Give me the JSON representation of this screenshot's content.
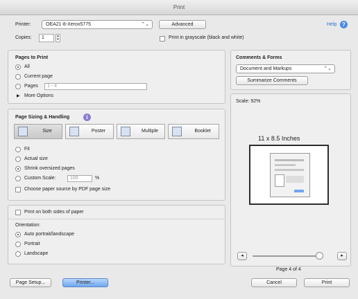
{
  "window": {
    "title": "Print"
  },
  "header": {
    "printer_label": "Printer:",
    "printer_value": "OEA21-8-Xerox5775",
    "advanced_button": "Advanced",
    "help_link": "Help",
    "copies_label": "Copies:",
    "copies_value": "1",
    "grayscale_label": "Print in grayscale (black and white)"
  },
  "pages_to_print": {
    "title": "Pages to Print",
    "options": [
      "All",
      "Current page",
      "Pages"
    ],
    "selected": "All",
    "pages_placeholder": "1 - 4",
    "more_options": "More Options"
  },
  "page_sizing": {
    "title": "Page Sizing & Handling",
    "tabs": [
      "Size",
      "Poster",
      "Multiple",
      "Booklet"
    ],
    "selected_tab": "Size",
    "fit": "Fit",
    "actual_size": "Actual size",
    "shrink": "Shrink oversized pages",
    "custom_scale": "Custom Scale:",
    "custom_scale_value": "100",
    "percent": "%",
    "selected_option": "Shrink oversized pages",
    "paper_source": "Choose paper source by PDF page size"
  },
  "orientation": {
    "both_sides": "Print on both sides of paper",
    "title": "Orientation:",
    "options": [
      "Auto portrait/landscape",
      "Portrait",
      "Landscape"
    ],
    "selected": "Auto portrait/landscape"
  },
  "comments": {
    "title": "Comments & Forms",
    "popup_value": "Document and Markups",
    "summarize_button": "Summarize Comments"
  },
  "preview": {
    "scale": "Scale: 92%",
    "paper_size": "11 x 8.5 Inches",
    "page_indicator": "Page 4 of 4",
    "slider_level": 1.0
  },
  "footer": {
    "page_setup": "Page Setup...",
    "printer": "Printer...",
    "cancel": "Cancel",
    "print": "Print"
  },
  "colors": {
    "accent": "#4a8be0",
    "primary_button": "#6ea6f0"
  }
}
